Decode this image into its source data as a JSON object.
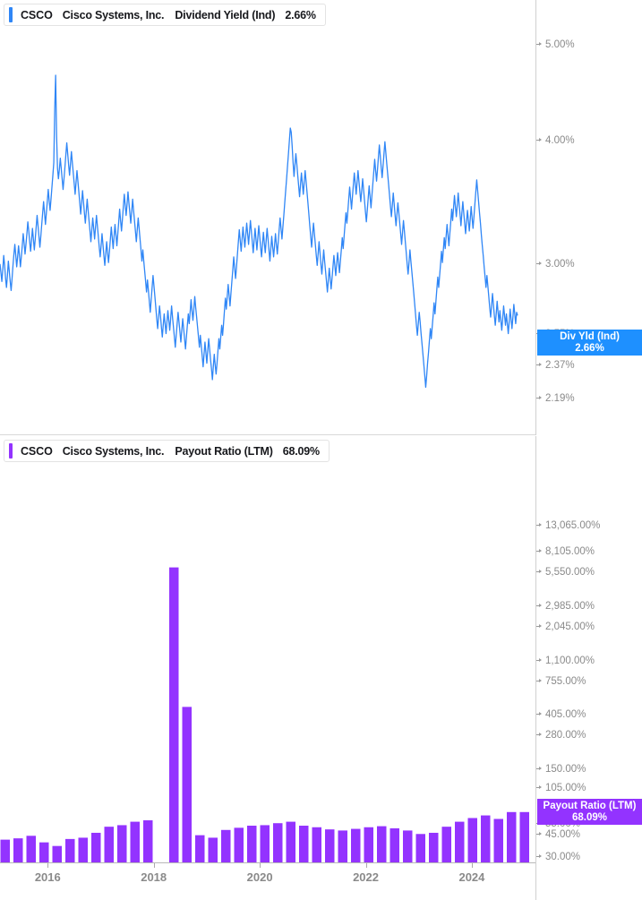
{
  "panels": [
    {
      "legend": {
        "ticker": "CSCO",
        "company": "Cisco Systems, Inc.",
        "metric": "Dividend Yield (Ind)",
        "value": "2.66%",
        "color": "#2f86f6"
      },
      "badge": {
        "title": "Div Yld (Ind)",
        "value": "2.66%",
        "color": "#1e90ff"
      }
    },
    {
      "legend": {
        "ticker": "CSCO",
        "company": "Cisco Systems, Inc.",
        "metric": "Payout Ratio (LTM)",
        "value": "68.09%",
        "color": "#9333ff"
      },
      "badge": {
        "title": "Payout Ratio (LTM)",
        "value": "68.09%",
        "color": "#9333ff"
      }
    }
  ],
  "chart_data": [
    {
      "type": "line",
      "title": "Dividend Yield (Ind)",
      "series_name": "Div Yld (Ind)",
      "color": "#2f86f6",
      "yscale": "log",
      "ylim": [
        2.08,
        5.35
      ],
      "ylabel": "",
      "xlabel": "",
      "grid": false,
      "legend_position": "top-left",
      "last_value": 2.66,
      "yticks": [
        "5.00%",
        "4.00%",
        "3.00%",
        "2.55%",
        "2.37%",
        "2.19%"
      ],
      "ytick_values": [
        5.0,
        4.0,
        3.0,
        2.55,
        2.37,
        2.19
      ],
      "xticks": [
        "2016",
        "2018",
        "2020",
        "2022",
        "2024"
      ],
      "xtick_values": [
        2016,
        2018,
        2020,
        2022,
        2024
      ],
      "x_start": 2015.1,
      "x_end": 2025.2,
      "values": [
        3.0,
        2.94,
        2.88,
        2.96,
        3.06,
        2.99,
        2.9,
        2.84,
        2.92,
        3.02,
        2.95,
        2.88,
        2.82,
        2.9,
        2.99,
        3.07,
        3.14,
        3.06,
        2.98,
        3.05,
        3.13,
        3.06,
        2.98,
        3.05,
        3.13,
        3.22,
        3.15,
        3.07,
        3.14,
        3.22,
        3.31,
        3.24,
        3.16,
        3.09,
        3.17,
        3.26,
        3.18,
        3.1,
        3.18,
        3.27,
        3.36,
        3.28,
        3.2,
        3.12,
        3.2,
        3.29,
        3.38,
        3.47,
        3.38,
        3.29,
        3.38,
        3.47,
        3.57,
        3.48,
        3.4,
        3.49,
        3.59,
        3.69,
        3.8,
        4.3,
        4.66,
        4.05,
        3.75,
        3.66,
        3.74,
        3.84,
        3.75,
        3.66,
        3.57,
        3.66,
        3.76,
        3.87,
        3.98,
        3.88,
        3.78,
        3.69,
        3.79,
        3.9,
        3.8,
        3.71,
        3.62,
        3.53,
        3.63,
        3.73,
        3.64,
        3.55,
        3.46,
        3.37,
        3.46,
        3.56,
        3.47,
        3.38,
        3.3,
        3.39,
        3.49,
        3.4,
        3.32,
        3.24,
        3.16,
        3.25,
        3.34,
        3.26,
        3.18,
        3.27,
        3.36,
        3.28,
        3.2,
        3.12,
        3.05,
        3.13,
        3.22,
        3.14,
        3.06,
        2.99,
        3.07,
        3.16,
        3.08,
        3.01,
        3.09,
        3.18,
        3.27,
        3.19,
        3.11,
        3.2,
        3.29,
        3.21,
        3.13,
        3.22,
        3.31,
        3.41,
        3.32,
        3.24,
        3.33,
        3.43,
        3.53,
        3.44,
        3.36,
        3.45,
        3.55,
        3.46,
        3.38,
        3.3,
        3.39,
        3.49,
        3.4,
        3.32,
        3.24,
        3.16,
        3.25,
        3.34,
        3.26,
        3.18,
        3.1,
        3.02,
        3.1,
        3.02,
        2.95,
        2.88,
        2.81,
        2.89,
        2.82,
        2.75,
        2.68,
        2.76,
        2.84,
        2.92,
        2.85,
        2.78,
        2.71,
        2.64,
        2.58,
        2.65,
        2.72,
        2.66,
        2.59,
        2.53,
        2.6,
        2.67,
        2.61,
        2.55,
        2.62,
        2.69,
        2.63,
        2.57,
        2.64,
        2.72,
        2.65,
        2.59,
        2.53,
        2.47,
        2.54,
        2.61,
        2.68,
        2.62,
        2.56,
        2.5,
        2.57,
        2.64,
        2.58,
        2.52,
        2.46,
        2.53,
        2.6,
        2.67,
        2.61,
        2.68,
        2.76,
        2.69,
        2.63,
        2.7,
        2.78,
        2.71,
        2.65,
        2.59,
        2.53,
        2.47,
        2.54,
        2.48,
        2.42,
        2.36,
        2.43,
        2.5,
        2.44,
        2.38,
        2.45,
        2.52,
        2.46,
        2.4,
        2.35,
        2.29,
        2.36,
        2.43,
        2.37,
        2.32,
        2.38,
        2.45,
        2.52,
        2.46,
        2.53,
        2.6,
        2.54,
        2.61,
        2.69,
        2.77,
        2.7,
        2.78,
        2.86,
        2.79,
        2.72,
        2.8,
        2.88,
        2.96,
        3.05,
        2.97,
        2.9,
        2.98,
        3.07,
        3.16,
        3.25,
        3.17,
        3.09,
        3.18,
        3.27,
        3.19,
        3.12,
        3.21,
        3.3,
        3.22,
        3.14,
        3.23,
        3.32,
        3.24,
        3.16,
        3.08,
        3.17,
        3.26,
        3.18,
        3.1,
        3.19,
        3.28,
        3.2,
        3.12,
        3.05,
        3.14,
        3.23,
        3.15,
        3.08,
        3.17,
        3.26,
        3.18,
        3.1,
        3.02,
        3.11,
        3.2,
        3.12,
        3.05,
        3.13,
        3.22,
        3.14,
        3.07,
        3.16,
        3.25,
        3.34,
        3.26,
        3.18,
        3.27,
        3.36,
        3.46,
        3.56,
        3.66,
        3.77,
        3.88,
        4.0,
        4.12,
        4.08,
        3.95,
        3.8,
        3.68,
        3.78,
        3.88,
        3.79,
        3.69,
        3.6,
        3.51,
        3.61,
        3.71,
        3.62,
        3.53,
        3.63,
        3.73,
        3.64,
        3.55,
        3.46,
        3.37,
        3.28,
        3.2,
        3.12,
        3.21,
        3.3,
        3.22,
        3.14,
        3.06,
        2.99,
        3.07,
        3.16,
        3.08,
        3.0,
        2.93,
        3.01,
        3.1,
        3.02,
        2.95,
        2.88,
        2.81,
        2.89,
        2.97,
        2.9,
        2.83,
        2.9,
        2.98,
        3.06,
        2.99,
        2.92,
        3.0,
        3.08,
        3.01,
        2.94,
        3.02,
        3.1,
        3.19,
        3.11,
        3.2,
        3.29,
        3.38,
        3.3,
        3.39,
        3.49,
        3.59,
        3.5,
        3.41,
        3.51,
        3.61,
        3.71,
        3.62,
        3.53,
        3.63,
        3.73,
        3.64,
        3.55,
        3.47,
        3.56,
        3.66,
        3.57,
        3.48,
        3.39,
        3.31,
        3.4,
        3.5,
        3.6,
        3.51,
        3.42,
        3.52,
        3.62,
        3.72,
        3.83,
        3.73,
        3.64,
        3.74,
        3.85,
        3.96,
        3.86,
        3.76,
        3.67,
        3.77,
        3.88,
        3.99,
        3.89,
        3.79,
        3.7,
        3.61,
        3.52,
        3.43,
        3.35,
        3.44,
        3.54,
        3.45,
        3.36,
        3.28,
        3.37,
        3.46,
        3.38,
        3.3,
        3.22,
        3.14,
        3.23,
        3.32,
        3.24,
        3.16,
        3.08,
        3.0,
        2.93,
        3.01,
        3.1,
        3.02,
        2.95,
        2.88,
        2.81,
        2.74,
        2.67,
        2.6,
        2.54,
        2.61,
        2.68,
        2.62,
        2.55,
        2.49,
        2.43,
        2.37,
        2.31,
        2.25,
        2.31,
        2.38,
        2.44,
        2.51,
        2.58,
        2.52,
        2.59,
        2.66,
        2.74,
        2.67,
        2.75,
        2.83,
        2.91,
        2.84,
        2.92,
        3.0,
        3.09,
        3.01,
        3.1,
        3.19,
        3.11,
        3.2,
        3.29,
        3.21,
        3.13,
        3.22,
        3.31,
        3.41,
        3.32,
        3.42,
        3.52,
        3.43,
        3.35,
        3.44,
        3.54,
        3.45,
        3.37,
        3.28,
        3.38,
        3.47,
        3.38,
        3.3,
        3.22,
        3.31,
        3.4,
        3.32,
        3.24,
        3.33,
        3.43,
        3.34,
        3.26,
        3.35,
        3.45,
        3.55,
        3.65,
        3.56,
        3.47,
        3.38,
        3.3,
        3.21,
        3.13,
        3.06,
        2.98,
        2.91,
        2.84,
        2.92,
        2.85,
        2.78,
        2.71,
        2.65,
        2.72,
        2.8,
        2.73,
        2.66,
        2.6,
        2.67,
        2.75,
        2.68,
        2.62,
        2.69,
        2.63,
        2.57,
        2.64,
        2.72,
        2.66,
        2.6,
        2.67,
        2.61,
        2.55,
        2.62,
        2.7,
        2.64,
        2.58,
        2.65,
        2.73,
        2.67,
        2.61,
        2.68,
        2.66
      ]
    },
    {
      "type": "bar",
      "title": "Payout Ratio (LTM)",
      "series_name": "Payout Ratio (LTM)",
      "color": "#9333ff",
      "yscale": "log",
      "ylim": [
        27.0,
        16000.0
      ],
      "ylabel": "",
      "xlabel": "",
      "grid": false,
      "legend_position": "top-left",
      "last_value": 68.09,
      "yticks": [
        "13,065.00%",
        "8,105.00%",
        "5,550.00%",
        "2,985.00%",
        "2,045.00%",
        "1,100.00%",
        "755.00%",
        "405.00%",
        "280.00%",
        "150.00%",
        "105.00%",
        "55.00%",
        "45.00%",
        "30.00%"
      ],
      "ytick_values": [
        13065,
        8105,
        5550,
        2985,
        2045,
        1100,
        755,
        405,
        280,
        150,
        105,
        55,
        45,
        30
      ],
      "xticks": [
        "2016",
        "2018",
        "2020",
        "2022",
        "2024"
      ],
      "xtick_values": [
        2016,
        2018,
        2020,
        2022,
        2024
      ],
      "x_start": 2015.1,
      "x_end": 2025.2,
      "bar_period": "quarterly",
      "categories": [
        "2015 Q1",
        "2015 Q2",
        "2015 Q3",
        "2015 Q4",
        "2016 Q1",
        "2016 Q2",
        "2016 Q3",
        "2016 Q4",
        "2017 Q1",
        "2017 Q2",
        "2017 Q3",
        "2017 Q4",
        "2018 Q1",
        "2018 Q2",
        "2018 Q3",
        "2018 Q4",
        "2019 Q1",
        "2019 Q2",
        "2019 Q3",
        "2019 Q4",
        "2020 Q1",
        "2020 Q2",
        "2020 Q3",
        "2020 Q4",
        "2021 Q1",
        "2021 Q2",
        "2021 Q3",
        "2021 Q4",
        "2022 Q1",
        "2022 Q2",
        "2022 Q3",
        "2022 Q4",
        "2023 Q1",
        "2023 Q2",
        "2023 Q3",
        "2023 Q4",
        "2024 Q1",
        "2024 Q2",
        "2024 Q3",
        "2024 Q4",
        "2025 Q1"
      ],
      "values": [
        41.0,
        42.0,
        44.0,
        39.0,
        36.5,
        41.5,
        42.5,
        46.5,
        52.0,
        53.5,
        57.0,
        58.5,
        null,
        6100.0,
        470.0,
        44.5,
        42.5,
        49.0,
        51.0,
        53.0,
        53.5,
        55.5,
        57.0,
        53.0,
        51.5,
        49.5,
        48.5,
        50.0,
        51.5,
        52.5,
        50.5,
        48.5,
        45.5,
        46.5,
        52.0,
        57.0,
        61.0,
        64.0,
        60.0,
        68.09,
        68.09
      ]
    }
  ]
}
